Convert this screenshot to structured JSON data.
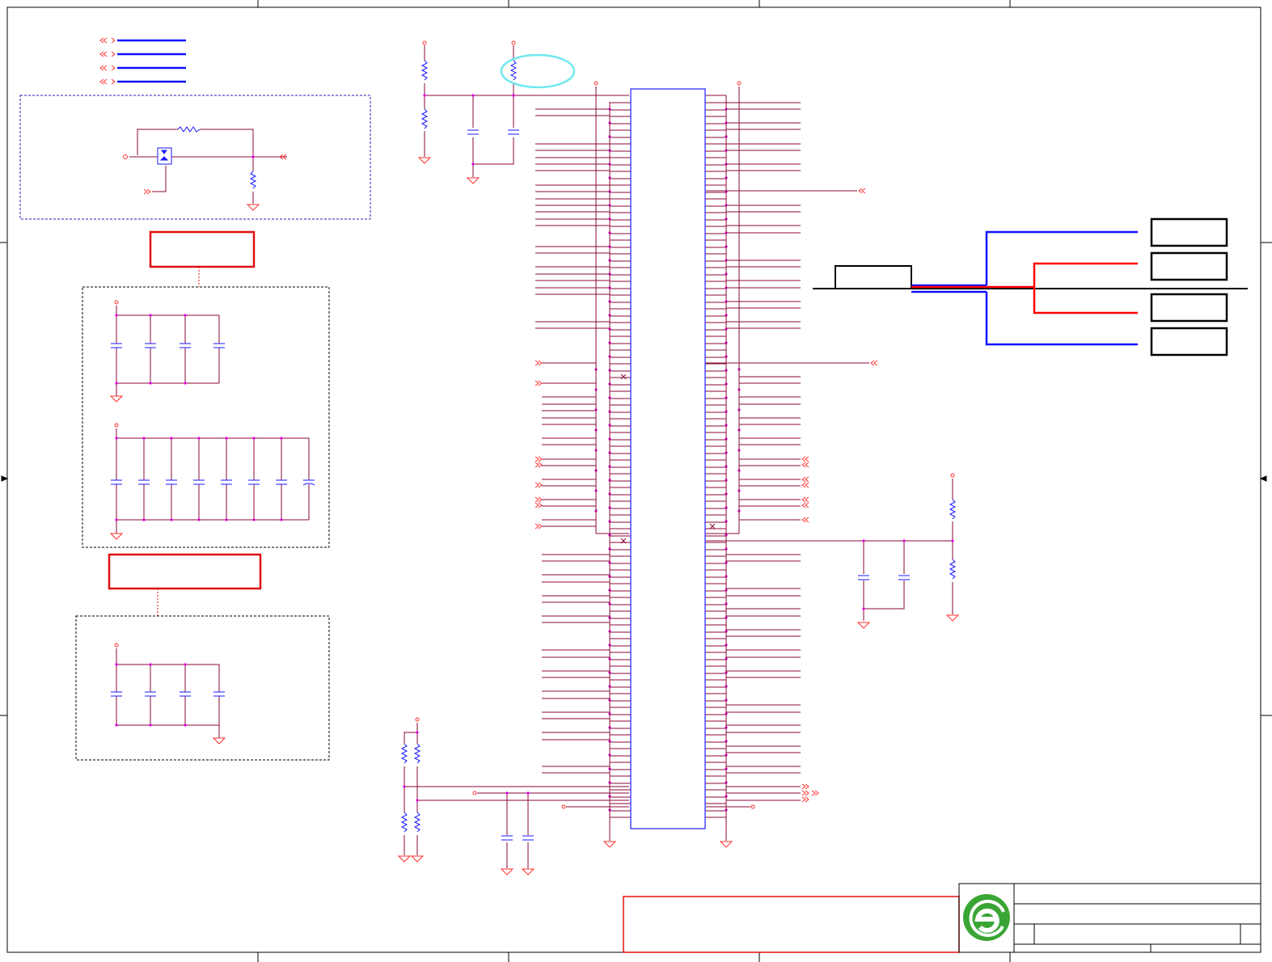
{
  "sheet": {
    "title": "",
    "logo": {
      "name": "company-logo-e",
      "color": "#3aa535"
    }
  },
  "colors": {
    "net_wire": "#8b0a3a",
    "symbol_blue": "#1a1aff",
    "frame_red": "#e01010",
    "junction": "#e000e0",
    "highlight_circle": "#70e8f0",
    "bus_blue": "#1010ff",
    "bus_red": "#ff0000",
    "frame_black": "#000000"
  },
  "icons": [
    "resistor-icon",
    "capacitor-icon",
    "ground-icon",
    "offpage-connector-icon",
    "power-rail-icon",
    "mosfet-icon",
    "ic-body"
  ]
}
